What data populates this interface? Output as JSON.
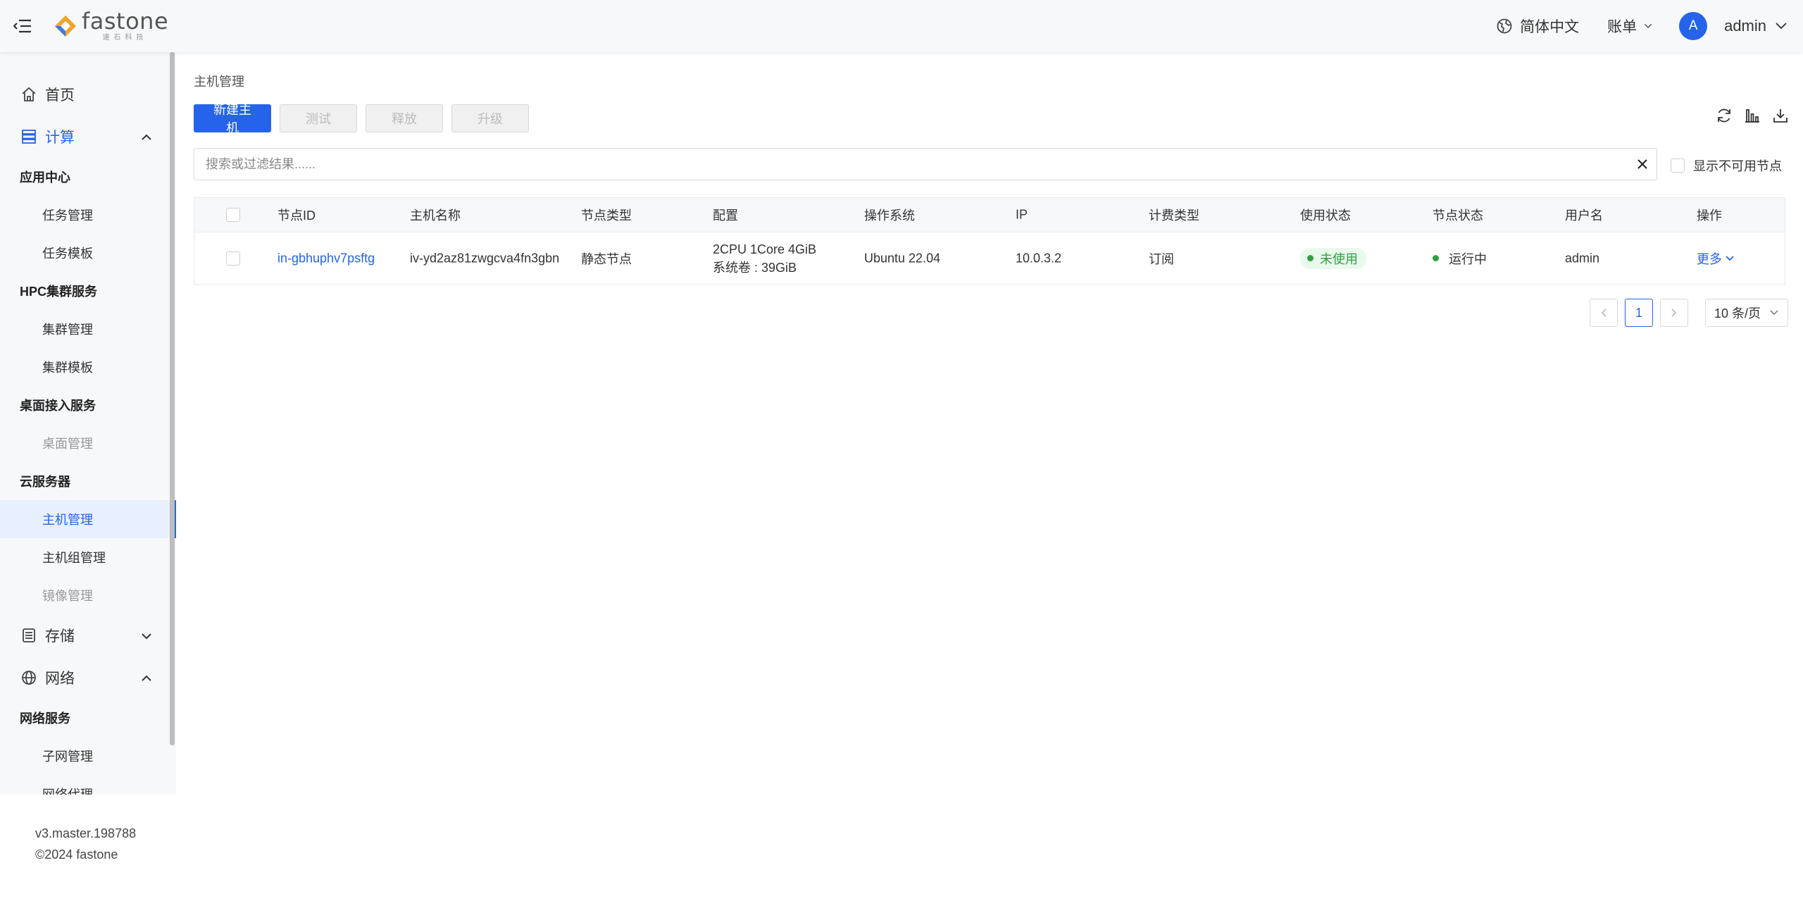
{
  "header": {
    "logo_text": "fastone",
    "logo_sub": "速石科技",
    "language": "简体中文",
    "billing": "账单",
    "avatar_letter": "A",
    "user": "admin",
    "accent_color": "#2563eb"
  },
  "sidebar": {
    "home": "首页",
    "compute": "计算",
    "app_center": "应用中心",
    "task_mgmt": "任务管理",
    "task_template": "任务模板",
    "hpc_service": "HPC集群服务",
    "cluster_mgmt": "集群管理",
    "cluster_template": "集群模板",
    "desktop_service": "桌面接入服务",
    "desktop_mgmt": "桌面管理",
    "cloud_server": "云服务器",
    "host_mgmt": "主机管理",
    "host_group_mgmt": "主机组管理",
    "image_mgmt": "镜像管理",
    "storage": "存储",
    "network": "网络",
    "network_service": "网络服务",
    "subnet_mgmt": "子网管理",
    "network_proxy": "网络代理"
  },
  "footer": {
    "version": "v3.master.198788",
    "copyright": "©2024 fastone"
  },
  "main": {
    "breadcrumb": "主机管理",
    "toolbar": {
      "new_host": "新建主机",
      "test": "测试",
      "release": "释放",
      "upgrade": "升级"
    },
    "search_placeholder": "搜索或过滤结果......",
    "show_unavailable": "显示不可用节点",
    "table": {
      "headers": [
        "节点ID",
        "主机名称",
        "节点类型",
        "配置",
        "操作系统",
        "IP",
        "计费类型",
        "使用状态",
        "节点状态",
        "用户名",
        "操作"
      ],
      "rows": [
        {
          "node_id": "in-gbhuphv7psftg",
          "host_name": "iv-yd2az81zwgcva4fn3gbn",
          "node_type": "静态节点",
          "config_line1": "2CPU 1Core 4GiB",
          "config_line2": "系统卷 : 39GiB",
          "os": "Ubuntu 22.04",
          "ip": "10.0.3.2",
          "billing": "订阅",
          "usage_status": "未使用",
          "node_status": "运行中",
          "username": "admin",
          "action": "更多"
        }
      ]
    },
    "pagination": {
      "current_page": "1",
      "page_size": "10 条/页"
    }
  }
}
